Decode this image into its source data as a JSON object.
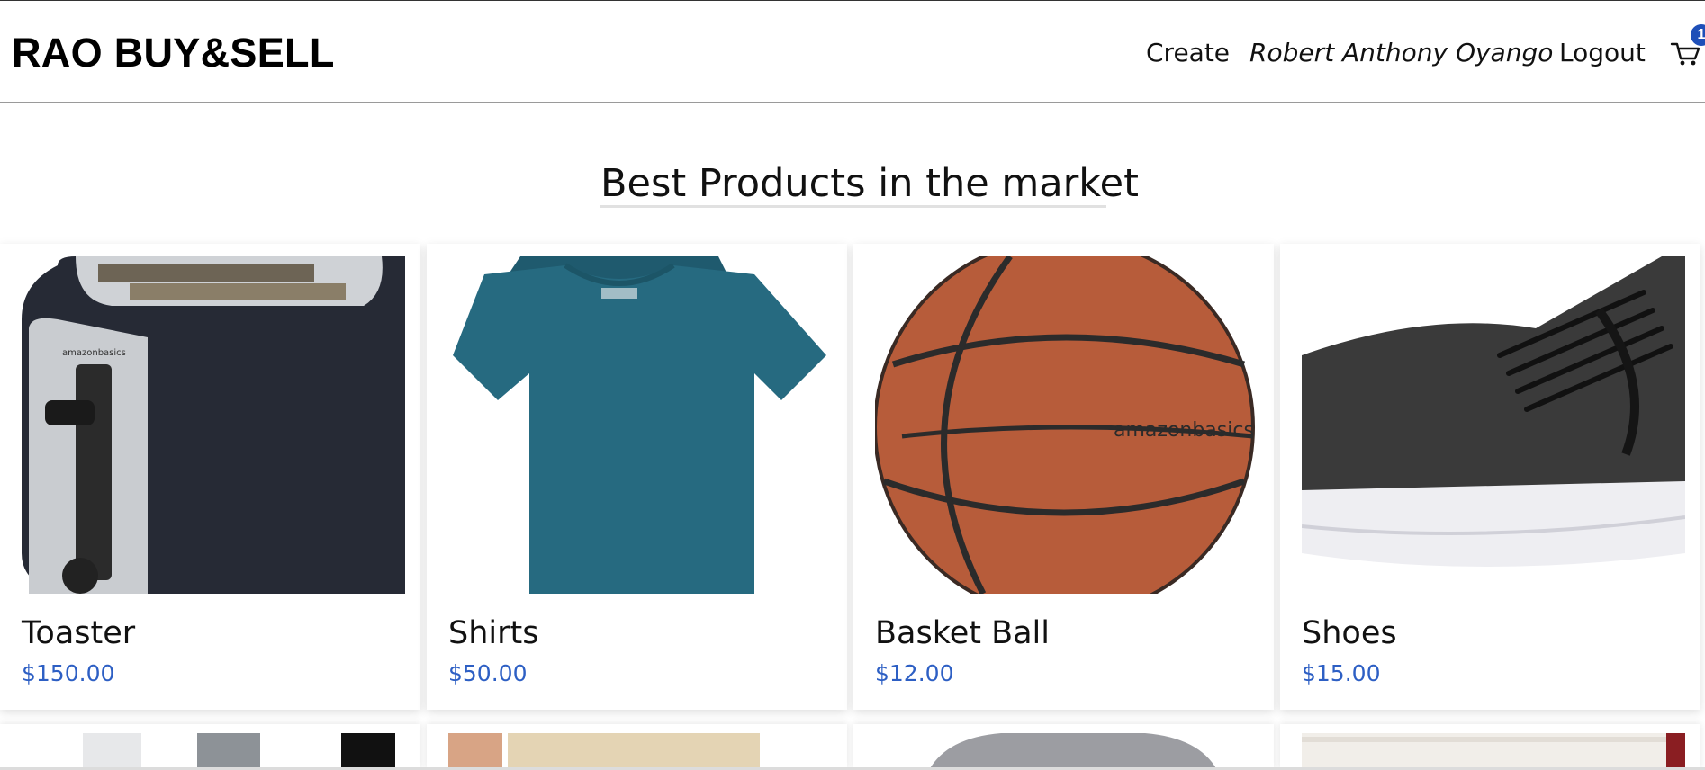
{
  "header": {
    "brand": "RAO BUY&SELL",
    "nav": {
      "create": "Create",
      "user": "Robert Anthony Oyango",
      "logout": "Logout"
    },
    "cart": {
      "icon": "cart-icon",
      "count": "1"
    }
  },
  "main": {
    "title": "Best Products in the market",
    "products": [
      {
        "name": "Toaster",
        "price": "$150.00",
        "image": "toaster-image"
      },
      {
        "name": "Shirts",
        "price": "$50.00",
        "image": "shirts-image"
      },
      {
        "name": "Basket Ball",
        "price": "$12.00",
        "image": "basketball-image"
      },
      {
        "name": "Shoes",
        "price": "$15.00",
        "image": "shoes-image"
      }
    ]
  },
  "colors": {
    "price": "#2d5fc4",
    "badge": "#1e4fb8"
  }
}
